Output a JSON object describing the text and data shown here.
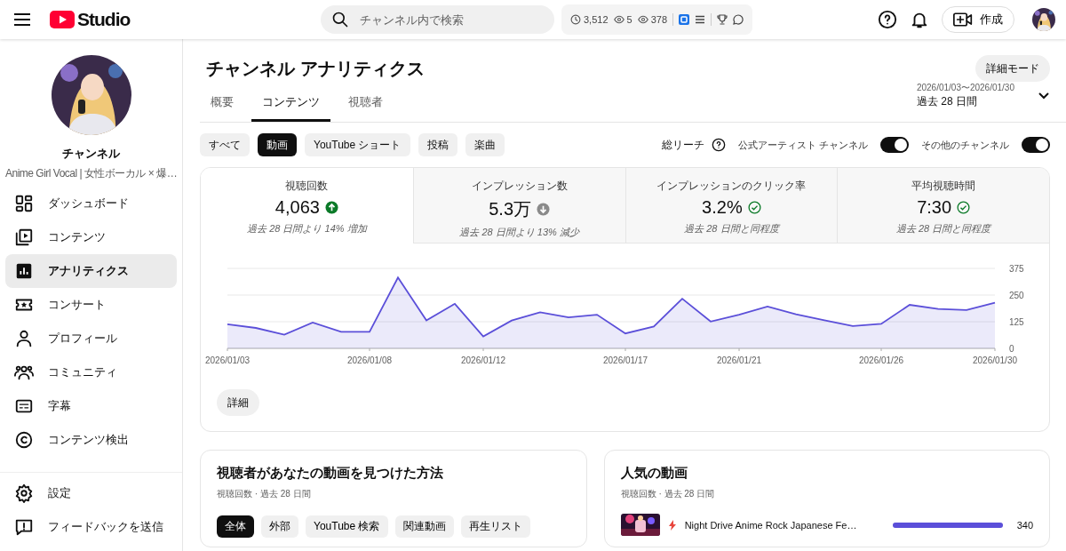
{
  "header": {
    "logo": "Studio",
    "search": {
      "placeholder": "チャンネル内で検索"
    },
    "stats": [
      {
        "kind": "clock",
        "value": "3,512"
      },
      {
        "kind": "eye",
        "value": "5"
      },
      {
        "kind": "eye",
        "value": "378"
      }
    ],
    "create_button": "作成"
  },
  "sidebar": {
    "channel_name": "チャンネル",
    "channel_description": "Anime Girl Vocal | 女性ボーカル × 爆…",
    "items": [
      {
        "label": "ダッシュボード",
        "kind": "dashboard",
        "selected": false
      },
      {
        "label": "コンテンツ",
        "kind": "content",
        "selected": false
      },
      {
        "label": "アナリティクス",
        "kind": "analytics",
        "selected": true
      },
      {
        "label": "コンサート",
        "kind": "ticket",
        "selected": false
      },
      {
        "label": "プロフィール",
        "kind": "person",
        "selected": false
      },
      {
        "label": "コミュニティ",
        "kind": "people",
        "selected": false
      },
      {
        "label": "字幕",
        "kind": "subtitles",
        "selected": false
      },
      {
        "label": "コンテンツ検出",
        "kind": "copyright",
        "selected": false
      }
    ],
    "bottom_items": [
      {
        "label": "設定",
        "kind": "gear"
      },
      {
        "label": "フィードバックを送信",
        "kind": "feedback"
      }
    ]
  },
  "page": {
    "title": "チャンネル アナリティクス",
    "advanced_button": "詳細モード",
    "tabs": [
      {
        "label": "概要",
        "selected": false
      },
      {
        "label": "コンテンツ",
        "selected": true
      },
      {
        "label": "視聴者",
        "selected": false
      }
    ],
    "date_range": "2026/01/03〜2026/01/30",
    "period": "過去 28 日間"
  },
  "filters": [
    {
      "label": "すべて",
      "selected": false
    },
    {
      "label": "動画",
      "selected": true
    },
    {
      "label": "YouTube ショート",
      "selected": false
    },
    {
      "label": "投稿",
      "selected": false
    },
    {
      "label": "楽曲",
      "selected": false
    }
  ],
  "reach_label": "総リーチ",
  "toggles": [
    {
      "label": "公式アーティスト チャンネル",
      "on": true
    },
    {
      "label": "その他のチャンネル",
      "on": true
    }
  ],
  "metrics": [
    {
      "label": "視聴回数",
      "value": "4,063",
      "kind": "up",
      "comparison": "過去 28 日間より 14% 増加",
      "selected": true
    },
    {
      "label": "インプレッション数",
      "value": "5.3万",
      "kind": "down",
      "comparison": "過去 28 日間より 13% 減少",
      "selected": false
    },
    {
      "label": "インプレッションのクリック率",
      "value": "3.2%",
      "kind": "same",
      "comparison": "過去 28 日間と同程度",
      "selected": false
    },
    {
      "label": "平均視聴時間",
      "value": "7:30",
      "kind": "same",
      "comparison": "過去 28 日間と同程度",
      "selected": false
    }
  ],
  "chart_data": {
    "type": "area",
    "categories": [
      "2026/01/03",
      null,
      null,
      null,
      null,
      "2026/01/08",
      null,
      null,
      null,
      "2026/01/12",
      null,
      null,
      null,
      null,
      "2026/01/17",
      null,
      null,
      null,
      "2026/01/21",
      null,
      null,
      null,
      null,
      "2026/01/26",
      null,
      null,
      null,
      "2026/01/30"
    ],
    "series": [
      {
        "color": "#5b4fd9",
        "values": [
          113,
          96,
          64,
          121,
          78,
          78,
          332,
          131,
          209,
          56,
          131,
          169,
          145,
          158,
          70,
          102,
          233,
          126,
          158,
          196,
          160,
          132,
          105,
          115,
          204,
          185,
          180,
          214
        ]
      }
    ],
    "ylim": [
      0,
      375
    ],
    "yticks": [
      0,
      125,
      250,
      375
    ]
  },
  "details_button": "詳細",
  "discovery": {
    "title": "視聴者があなたの動画を見つけた方法",
    "subtitle": "視聴回数 · 過去 28 日間",
    "chips": [
      {
        "label": "全体",
        "selected": true
      },
      {
        "label": "外部",
        "selected": false
      },
      {
        "label": "YouTube 検索",
        "selected": false
      },
      {
        "label": "関連動画",
        "selected": false
      },
      {
        "label": "再生リスト",
        "selected": false
      }
    ]
  },
  "top_videos": {
    "title": "人気の動画",
    "subtitle": "視聴回数 · 過去 28 日間",
    "videos": [
      {
        "title": "Night Drive Anime Rock Japanese Fe…",
        "views": "340",
        "level": 1
      }
    ]
  }
}
